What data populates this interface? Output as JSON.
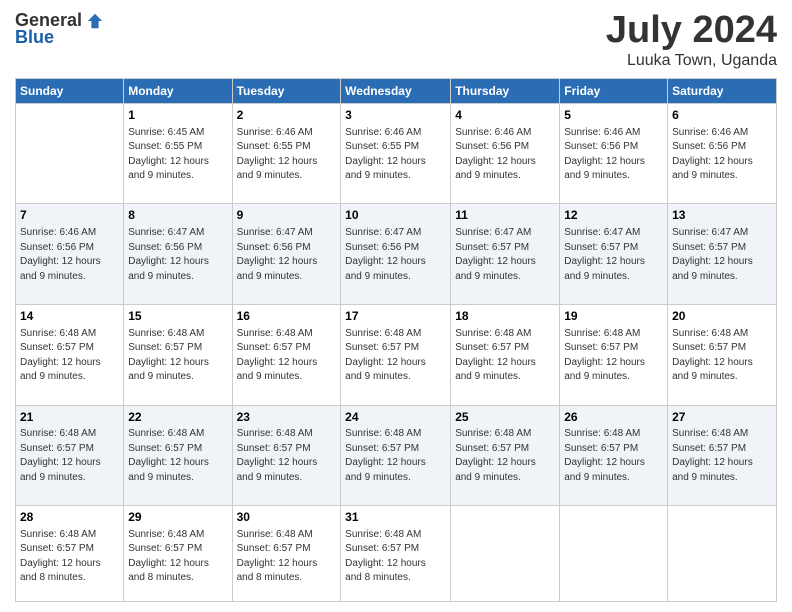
{
  "header": {
    "logo_general": "General",
    "logo_blue": "Blue",
    "month_title": "July 2024",
    "location": "Luuka Town, Uganda"
  },
  "days_of_week": [
    "Sunday",
    "Monday",
    "Tuesday",
    "Wednesday",
    "Thursday",
    "Friday",
    "Saturday"
  ],
  "weeks": [
    [
      {
        "day": "",
        "info": ""
      },
      {
        "day": "1",
        "info": "Sunrise: 6:45 AM\nSunset: 6:55 PM\nDaylight: 12 hours\nand 9 minutes."
      },
      {
        "day": "2",
        "info": "Sunrise: 6:46 AM\nSunset: 6:55 PM\nDaylight: 12 hours\nand 9 minutes."
      },
      {
        "day": "3",
        "info": "Sunrise: 6:46 AM\nSunset: 6:55 PM\nDaylight: 12 hours\nand 9 minutes."
      },
      {
        "day": "4",
        "info": "Sunrise: 6:46 AM\nSunset: 6:56 PM\nDaylight: 12 hours\nand 9 minutes."
      },
      {
        "day": "5",
        "info": "Sunrise: 6:46 AM\nSunset: 6:56 PM\nDaylight: 12 hours\nand 9 minutes."
      },
      {
        "day": "6",
        "info": "Sunrise: 6:46 AM\nSunset: 6:56 PM\nDaylight: 12 hours\nand 9 minutes."
      }
    ],
    [
      {
        "day": "7",
        "info": "Sunrise: 6:46 AM\nSunset: 6:56 PM\nDaylight: 12 hours\nand 9 minutes."
      },
      {
        "day": "8",
        "info": "Sunrise: 6:47 AM\nSunset: 6:56 PM\nDaylight: 12 hours\nand 9 minutes."
      },
      {
        "day": "9",
        "info": "Sunrise: 6:47 AM\nSunset: 6:56 PM\nDaylight: 12 hours\nand 9 minutes."
      },
      {
        "day": "10",
        "info": "Sunrise: 6:47 AM\nSunset: 6:56 PM\nDaylight: 12 hours\nand 9 minutes."
      },
      {
        "day": "11",
        "info": "Sunrise: 6:47 AM\nSunset: 6:57 PM\nDaylight: 12 hours\nand 9 minutes."
      },
      {
        "day": "12",
        "info": "Sunrise: 6:47 AM\nSunset: 6:57 PM\nDaylight: 12 hours\nand 9 minutes."
      },
      {
        "day": "13",
        "info": "Sunrise: 6:47 AM\nSunset: 6:57 PM\nDaylight: 12 hours\nand 9 minutes."
      }
    ],
    [
      {
        "day": "14",
        "info": "Sunrise: 6:48 AM\nSunset: 6:57 PM\nDaylight: 12 hours\nand 9 minutes."
      },
      {
        "day": "15",
        "info": "Sunrise: 6:48 AM\nSunset: 6:57 PM\nDaylight: 12 hours\nand 9 minutes."
      },
      {
        "day": "16",
        "info": "Sunrise: 6:48 AM\nSunset: 6:57 PM\nDaylight: 12 hours\nand 9 minutes."
      },
      {
        "day": "17",
        "info": "Sunrise: 6:48 AM\nSunset: 6:57 PM\nDaylight: 12 hours\nand 9 minutes."
      },
      {
        "day": "18",
        "info": "Sunrise: 6:48 AM\nSunset: 6:57 PM\nDaylight: 12 hours\nand 9 minutes."
      },
      {
        "day": "19",
        "info": "Sunrise: 6:48 AM\nSunset: 6:57 PM\nDaylight: 12 hours\nand 9 minutes."
      },
      {
        "day": "20",
        "info": "Sunrise: 6:48 AM\nSunset: 6:57 PM\nDaylight: 12 hours\nand 9 minutes."
      }
    ],
    [
      {
        "day": "21",
        "info": "Sunrise: 6:48 AM\nSunset: 6:57 PM\nDaylight: 12 hours\nand 9 minutes."
      },
      {
        "day": "22",
        "info": "Sunrise: 6:48 AM\nSunset: 6:57 PM\nDaylight: 12 hours\nand 9 minutes."
      },
      {
        "day": "23",
        "info": "Sunrise: 6:48 AM\nSunset: 6:57 PM\nDaylight: 12 hours\nand 9 minutes."
      },
      {
        "day": "24",
        "info": "Sunrise: 6:48 AM\nSunset: 6:57 PM\nDaylight: 12 hours\nand 9 minutes."
      },
      {
        "day": "25",
        "info": "Sunrise: 6:48 AM\nSunset: 6:57 PM\nDaylight: 12 hours\nand 9 minutes."
      },
      {
        "day": "26",
        "info": "Sunrise: 6:48 AM\nSunset: 6:57 PM\nDaylight: 12 hours\nand 9 minutes."
      },
      {
        "day": "27",
        "info": "Sunrise: 6:48 AM\nSunset: 6:57 PM\nDaylight: 12 hours\nand 9 minutes."
      }
    ],
    [
      {
        "day": "28",
        "info": "Sunrise: 6:48 AM\nSunset: 6:57 PM\nDaylight: 12 hours\nand 8 minutes."
      },
      {
        "day": "29",
        "info": "Sunrise: 6:48 AM\nSunset: 6:57 PM\nDaylight: 12 hours\nand 8 minutes."
      },
      {
        "day": "30",
        "info": "Sunrise: 6:48 AM\nSunset: 6:57 PM\nDaylight: 12 hours\nand 8 minutes."
      },
      {
        "day": "31",
        "info": "Sunrise: 6:48 AM\nSunset: 6:57 PM\nDaylight: 12 hours\nand 8 minutes."
      },
      {
        "day": "",
        "info": ""
      },
      {
        "day": "",
        "info": ""
      },
      {
        "day": "",
        "info": ""
      }
    ]
  ]
}
